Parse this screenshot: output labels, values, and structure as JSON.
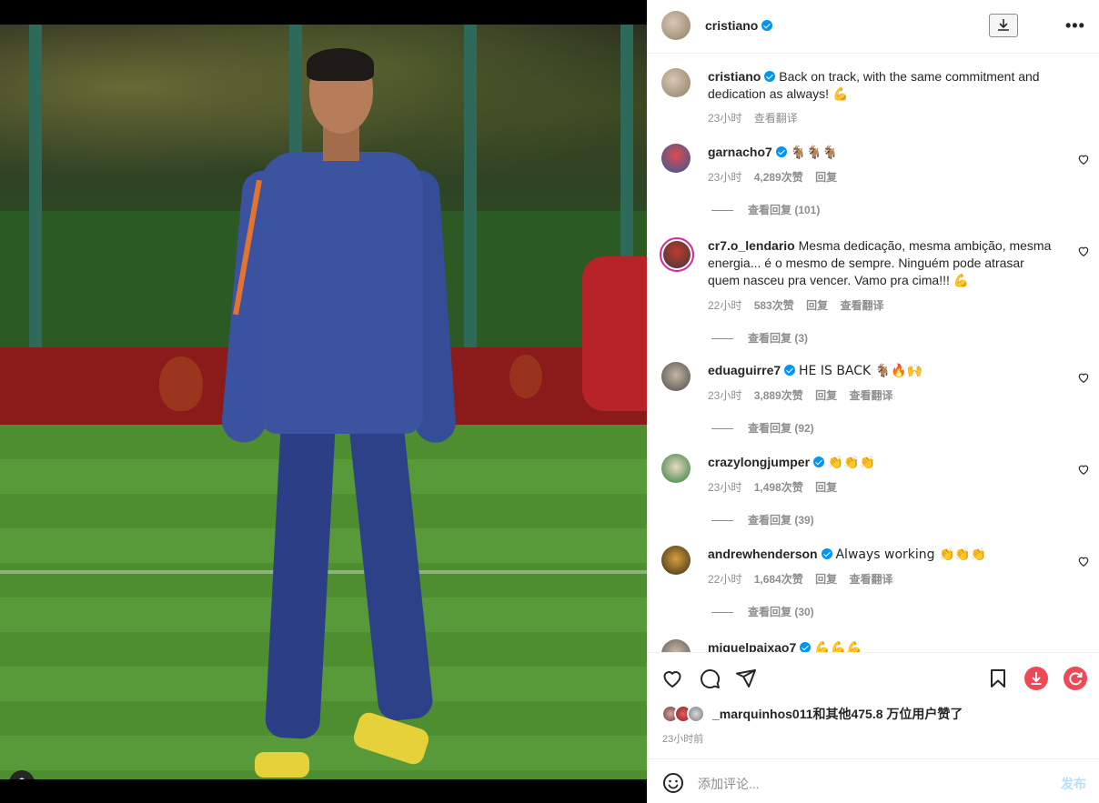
{
  "post": {
    "author": "cristiano",
    "download_icon": "download-icon",
    "more_icon": "more-options-icon",
    "more_label": "•••"
  },
  "caption": {
    "username": "cristiano",
    "text": "Back on track, with the same commitment and dedication as always! 💪",
    "time": "23小时",
    "translate": "查看翻译"
  },
  "comments": [
    {
      "username": "garnacho7",
      "verified": true,
      "text": "🐐🐐🐐",
      "time": "23小时",
      "likes": "4,289次赞",
      "reply": "回复",
      "translate": "",
      "view_replies": "查看回复 (101)"
    },
    {
      "username": "cr7.o_lendario",
      "verified": false,
      "text": "Mesma dedicação, mesma ambição, mesma energia... é o mesmo de sempre. Ninguém pode atrasar quem nasceu pra vencer. Vamo pra cima!!! 💪",
      "time": "22小时",
      "likes": "583次赞",
      "reply": "回复",
      "translate": "查看翻译",
      "view_replies": "查看回复 (3)"
    },
    {
      "username": "eduaguirre7",
      "verified": true,
      "text": "HE IS BACK 🐐🔥🙌",
      "time": "23小时",
      "likes": "3,889次赞",
      "reply": "回复",
      "translate": "查看翻译",
      "view_replies": "查看回复 (92)"
    },
    {
      "username": "crazylongjumper",
      "verified": true,
      "text": "👏👏👏",
      "time": "23小时",
      "likes": "1,498次赞",
      "reply": "回复",
      "translate": "",
      "view_replies": "查看回复 (39)"
    },
    {
      "username": "andrewhenderson",
      "verified": true,
      "text": "Always working 👏👏👏",
      "time": "22小时",
      "likes": "1,684次赞",
      "reply": "回复",
      "translate": "查看翻译",
      "view_replies": "查看回复 (30)"
    },
    {
      "username": "miguelpaixao7",
      "verified": true,
      "text": "💪💪💪",
      "time": "",
      "likes": "",
      "reply": "",
      "translate": "",
      "view_replies": ""
    }
  ],
  "likes_summary": "_marquinhos011和其他475.8 万位用户赞了",
  "post_time": "23小时前",
  "comment_box": {
    "placeholder": "添加评论...",
    "post_label": "发布"
  },
  "colors": {
    "accent_blue": "#0095f6",
    "download_red": "#ed4956",
    "refresh_red": "#ed4956"
  }
}
